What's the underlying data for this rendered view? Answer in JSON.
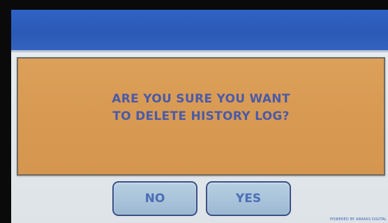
{
  "dialog": {
    "message_line1": "ARE YOU SURE YOU WANT",
    "message_line2": "TO DELETE HISTORY LOG?"
  },
  "buttons": {
    "no_label": "NO",
    "yes_label": "YES"
  },
  "footer": {
    "credit": "POWERED BY ARKAKS DIGITAL"
  },
  "colors": {
    "header_blue": "#2f63c4",
    "dialog_orange": "#d89a52",
    "text_blue": "#4a5aa8",
    "button_blue": "#a9c3da"
  }
}
